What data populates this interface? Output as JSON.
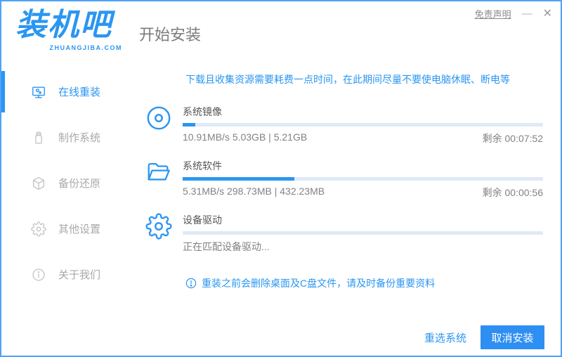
{
  "app": {
    "logo_text": "装机吧",
    "logo_domain": "ZHUANGJIBA.COM",
    "page_title": "开始安装",
    "disclaimer": "免责声明",
    "minimize_glyph": "—",
    "close_glyph": "✕"
  },
  "colors": {
    "accent": "#2b96f1",
    "button_blue": "#2e8ff2",
    "accent_border": "#4da2f8",
    "progress_track": "#e0eaf6"
  },
  "sidebar": {
    "items": [
      {
        "label": "在线重装",
        "icon": "monitor-reinstall-icon",
        "active": true
      },
      {
        "label": "制作系统",
        "icon": "usb-drive-icon",
        "active": false
      },
      {
        "label": "备份还原",
        "icon": "backup-restore-icon",
        "active": false
      },
      {
        "label": "其他设置",
        "icon": "settings-gear-icon",
        "active": false
      },
      {
        "label": "关于我们",
        "icon": "info-icon",
        "active": false
      }
    ]
  },
  "main": {
    "warning": "下载且收集资源需要耗费一点时间，在此期间尽量不要使电脑休眠、断电等",
    "tasks": [
      {
        "name": "系统镜像",
        "icon": "disc-icon",
        "progress_percent": 3.5,
        "stats": "10.91MB/s 5.03GB | 5.21GB",
        "remaining": "剩余 00:07:52"
      },
      {
        "name": "系统软件",
        "icon": "folder-icon",
        "progress_percent": 31,
        "stats": "5.31MB/s 298.73MB | 432.23MB",
        "remaining": "剩余 00:00:56"
      },
      {
        "name": "设备驱动",
        "icon": "gear-icon",
        "progress_percent": 0,
        "stats": "正在匹配设备驱动...",
        "remaining": ""
      }
    ],
    "note": "重装之前会删除桌面及C盘文件，请及时备份重要资料"
  },
  "footer": {
    "reselect_label": "重选系统",
    "cancel_label": "取消安装"
  }
}
